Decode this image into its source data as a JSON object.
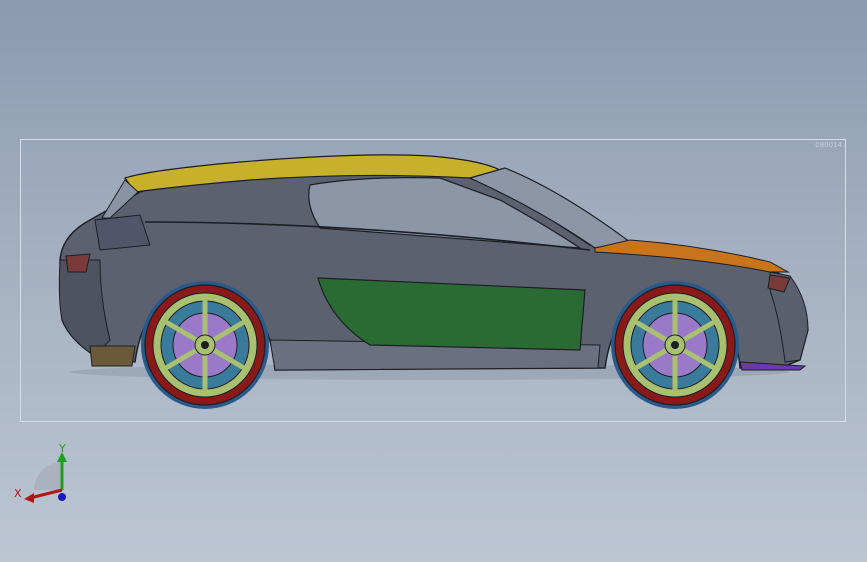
{
  "viewport": {
    "bbox_tag": "080014",
    "model": {
      "body_color": "#5c6170",
      "roof_color": "#c8b12a",
      "hood_color": "#c8741a",
      "door_panel_color": "#2a6a33",
      "tire_color": "#8a1a1a",
      "rim_color": "#a8c070",
      "brake_color": "#9a7ac8"
    }
  },
  "triad": {
    "x_label": "X",
    "y_label": "Y",
    "x_color": "#b01818",
    "y_color": "#1aa01a",
    "z_color": "#1818c0"
  }
}
